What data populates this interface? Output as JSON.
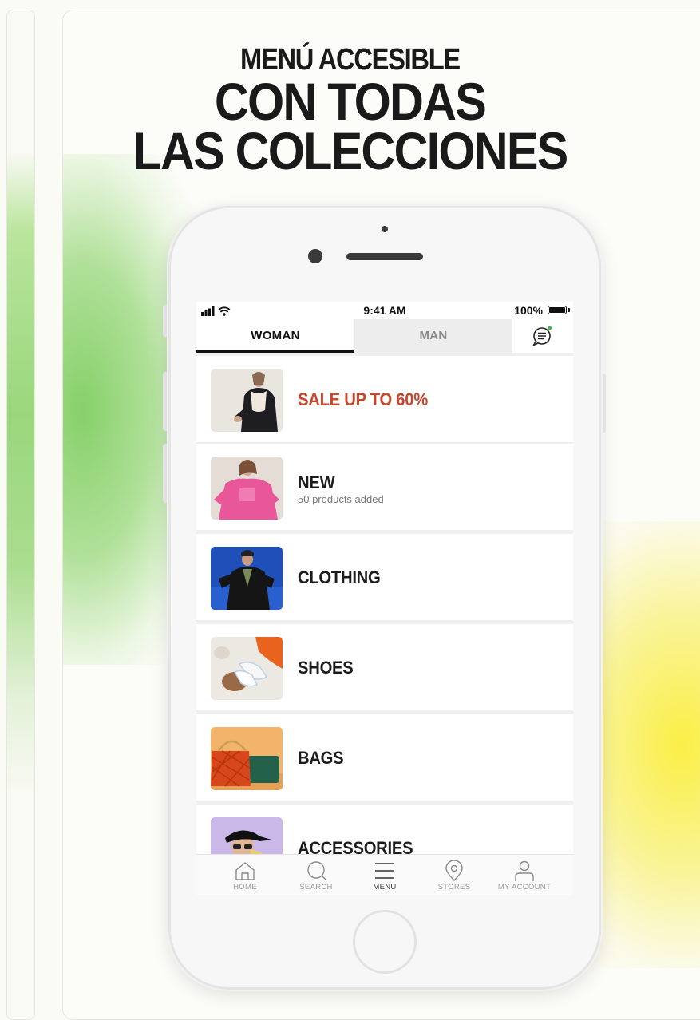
{
  "headline": {
    "line1": "MENÚ ACCESIBLE",
    "line2": "CON TODAS",
    "line3": "LAS COLECCIONES"
  },
  "status_bar": {
    "time": "9:41 AM",
    "battery_percent": "100%"
  },
  "tabs": [
    {
      "label": "WOMAN",
      "active": true
    },
    {
      "label": "MAN",
      "active": false
    }
  ],
  "chat_indicator_color": "#4caf50",
  "menu_items": [
    {
      "title": "SALE UP TO 60%",
      "subtitle": "",
      "highlight_color": "#c8462a"
    },
    {
      "title": "NEW",
      "subtitle": "50 products added"
    },
    {
      "title": "CLOTHING",
      "subtitle": ""
    },
    {
      "title": "SHOES",
      "subtitle": ""
    },
    {
      "title": "BAGS",
      "subtitle": ""
    },
    {
      "title": "ACCESSORIES",
      "subtitle": ""
    }
  ],
  "bottom_nav": [
    {
      "label": "HOME",
      "icon": "home-icon"
    },
    {
      "label": "SEARCH",
      "icon": "search-icon"
    },
    {
      "label": "MENU",
      "icon": "menu-icon",
      "active": true
    },
    {
      "label": "STORES",
      "icon": "location-pin-icon"
    },
    {
      "label": "MY ACCOUNT",
      "icon": "user-icon"
    }
  ]
}
